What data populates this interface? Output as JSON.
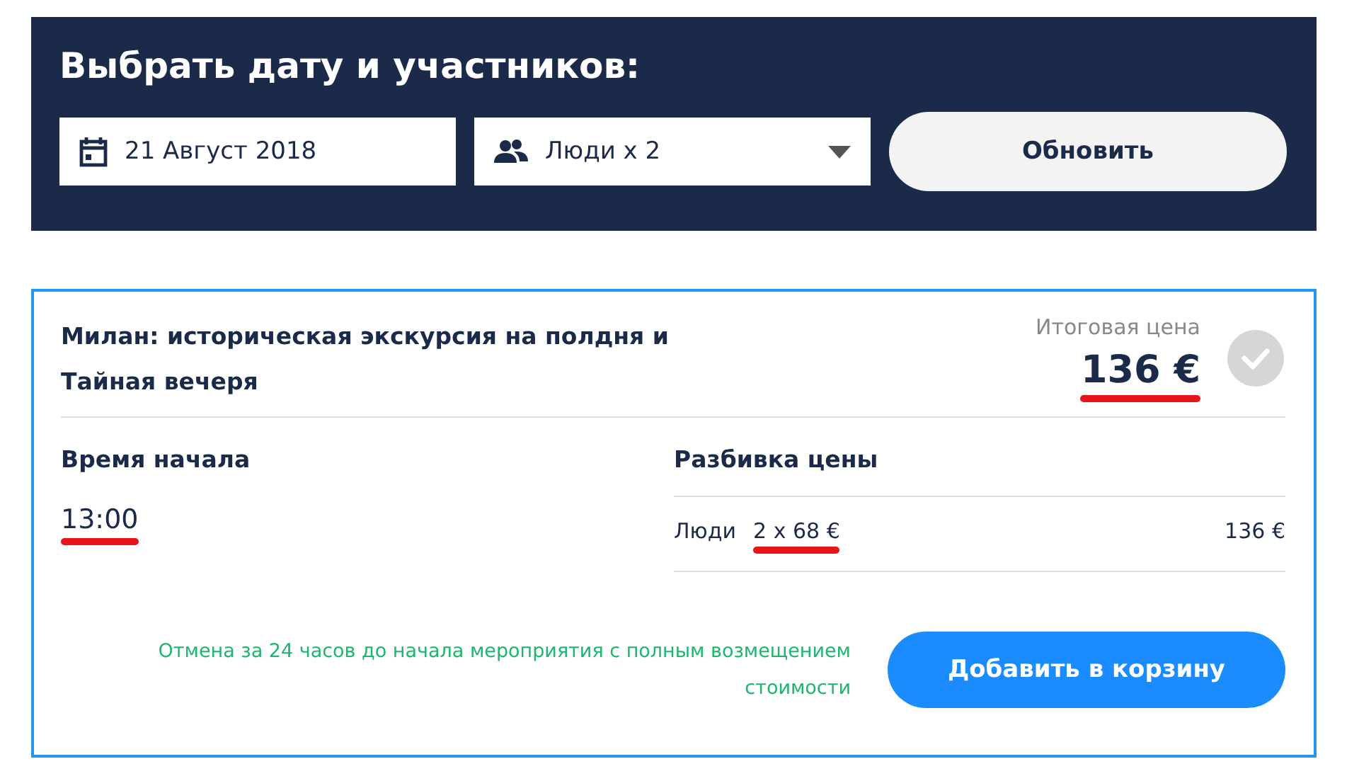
{
  "search_panel": {
    "title": "Выбрать дату и участников:",
    "date_field": {
      "value": "21 Август 2018"
    },
    "people_select": {
      "value": "Люди x 2"
    },
    "update_button": {
      "label": "Обновить"
    }
  },
  "offer": {
    "title": "Милан: историческая экскурсия на полдня и Тайная вечеря",
    "total_label": "Итоговая цена",
    "total": {
      "text": "136 €",
      "highlighted": true
    },
    "selected": false,
    "start_time": {
      "heading": "Время начала",
      "time": {
        "text": "13:00",
        "highlighted": true
      }
    },
    "price_breakdown": {
      "heading": "Разбивка цены",
      "rows": [
        {
          "label": "Люди",
          "unit": {
            "text": "2 x 68 €",
            "highlighted": true
          },
          "amount": "136 €"
        }
      ]
    },
    "cancellation_note": "Отмена за 24 часов до начала мероприятия с полным возмещением стоимости",
    "add_to_cart_button": {
      "label": "Добавить в корзину"
    }
  }
}
